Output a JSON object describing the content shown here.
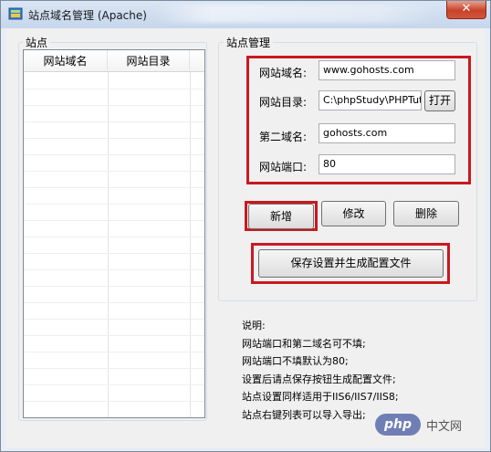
{
  "window": {
    "title": "站点域名管理 (Apache)",
    "close_glyph": "✕"
  },
  "sites_panel": {
    "label": "站点",
    "columns": [
      "网站域名",
      "网站目录"
    ]
  },
  "manage_panel": {
    "label": "站点管理",
    "fields": {
      "domain": {
        "label": "网站域名:",
        "value": "www.gohosts.com"
      },
      "directory": {
        "label": "网站目录:",
        "value": "C:\\phpStudy\\PHPTutor",
        "open_button": "打开"
      },
      "second_domain": {
        "label": "第二域名:",
        "value": "gohosts.com"
      },
      "port": {
        "label": "网站端口:",
        "value": "80"
      }
    },
    "buttons": {
      "add": "新增",
      "modify": "修改",
      "delete": "删除",
      "save": "保存设置并生成配置文件"
    }
  },
  "notes": [
    "说明:",
    "网站端口和第二域名可不填;",
    "网站端口不填默认为80;",
    "设置后请点保存按钮生成配置文件;",
    "站点设置同样适用于IIS6/IIS7/IIS8;",
    "站点右键列表可以导入导出;"
  ],
  "watermark": {
    "logo": "php",
    "text": "中文网"
  },
  "colors": {
    "highlight_red": "#c8191f",
    "close_red": "#c7432b"
  }
}
